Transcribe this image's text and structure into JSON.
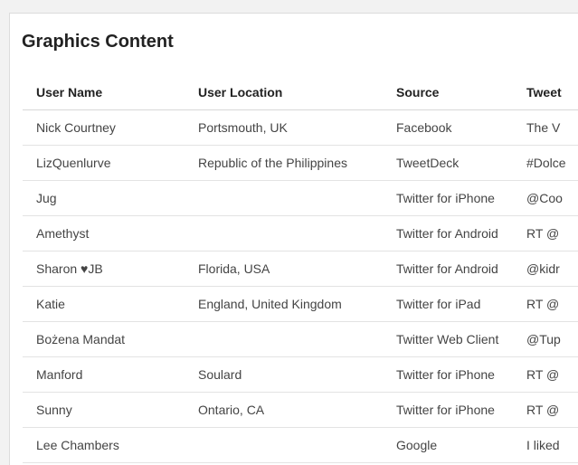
{
  "panel": {
    "title": "Graphics Content"
  },
  "table": {
    "headers": {
      "user_name": "User Name",
      "user_location": "User Location",
      "source": "Source",
      "tweet": "Tweet"
    },
    "rows": [
      {
        "user_name": "Nick Courtney",
        "user_location": "Portsmouth, UK",
        "source": "Facebook",
        "tweet": "The V"
      },
      {
        "user_name": "LizQuenlurve",
        "user_location": "Republic of the Philippines",
        "source": "TweetDeck",
        "tweet": "#Dolce"
      },
      {
        "user_name": "Jug",
        "user_location": "",
        "source": "Twitter for iPhone",
        "tweet": "@Coo"
      },
      {
        "user_name": "Amethyst",
        "user_location": "",
        "source": "Twitter for Android",
        "tweet": "RT @"
      },
      {
        "user_name": "Sharon ♥JB",
        "user_location": "Florida, USA",
        "source": "Twitter for Android",
        "tweet": "@kidr"
      },
      {
        "user_name": "Katie",
        "user_location": "England, United Kingdom",
        "source": "Twitter for iPad",
        "tweet": "RT @"
      },
      {
        "user_name": "Bożena Mandat",
        "user_location": "",
        "source": "Twitter Web Client",
        "tweet": "@Tup"
      },
      {
        "user_name": "Manford",
        "user_location": "Soulard",
        "source": "Twitter for iPhone",
        "tweet": "RT @"
      },
      {
        "user_name": "Sunny",
        "user_location": "Ontario, CA",
        "source": "Twitter for iPhone",
        "tweet": "RT @"
      },
      {
        "user_name": "Lee Chambers",
        "user_location": "",
        "source": "Google",
        "tweet": "I liked"
      }
    ]
  }
}
